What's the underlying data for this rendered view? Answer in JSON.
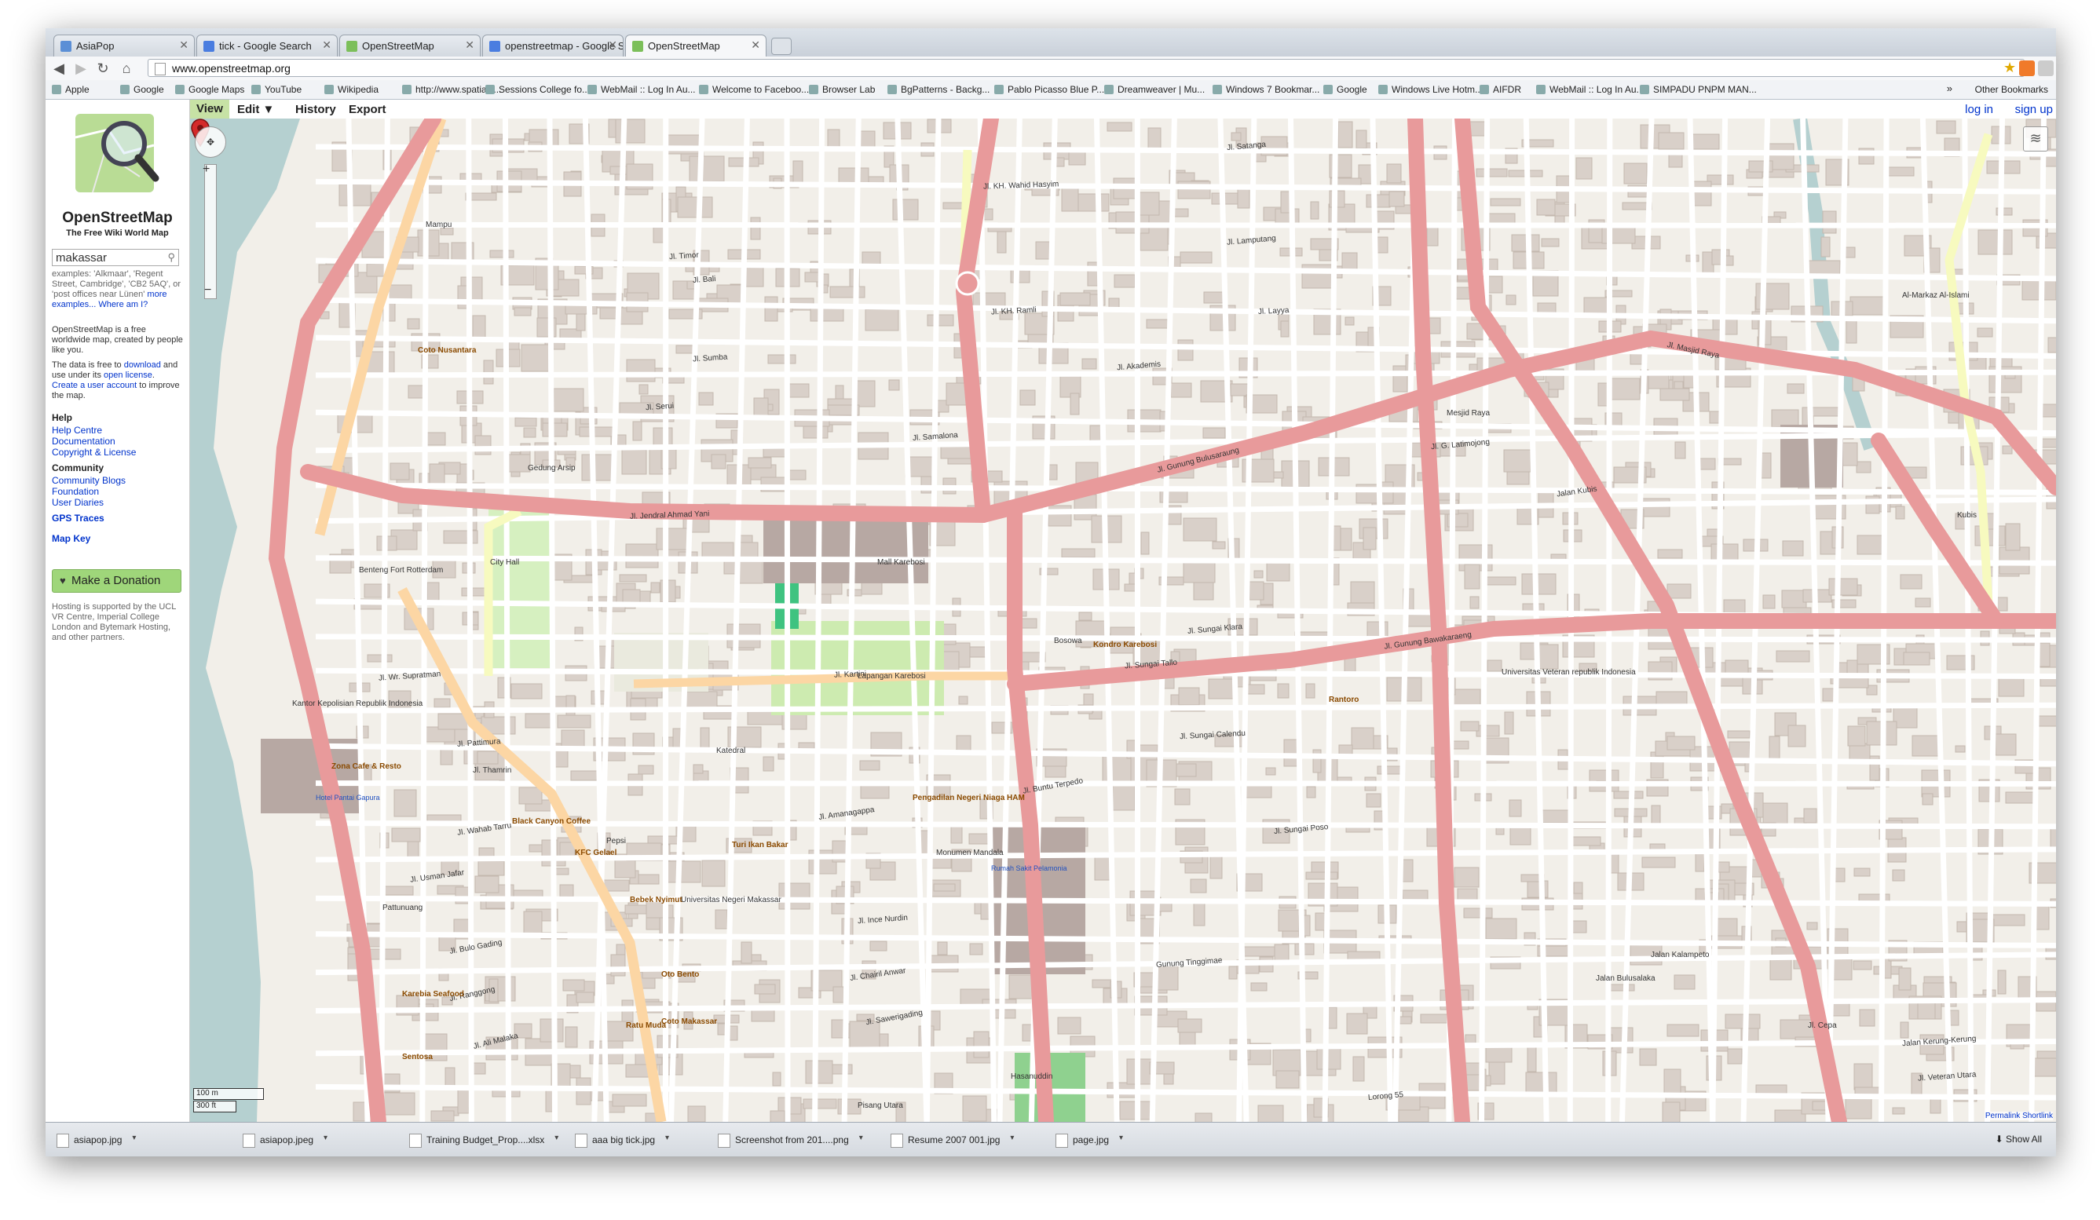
{
  "tabs": [
    {
      "title": "AsiaPop",
      "active": false
    },
    {
      "title": "tick - Google Search",
      "active": false
    },
    {
      "title": "OpenStreetMap",
      "active": false
    },
    {
      "title": "openstreetmap - Google S...",
      "active": false
    },
    {
      "title": "OpenStreetMap",
      "active": true
    }
  ],
  "toolbar": {
    "url": "www.openstreetmap.org"
  },
  "bookmarks": [
    "Apple",
    "Google",
    "Google Maps",
    "YouTube",
    "Wikipedia",
    "http://www.spatialc...",
    "Sessions College fo...",
    "WebMail :: Log In Au...",
    "Welcome to Faceboo...",
    "Browser Lab",
    "BgPatterns - Backg...",
    "Pablo Picasso Blue P...",
    "Dreamweaver | Mu...",
    "Windows 7 Bookmar...",
    "Google",
    "Windows Live Hotm...",
    "AIFDR",
    "WebMail :: Log In Au...",
    "SIMPADU PNPM MAN..."
  ],
  "other_bookmarks": "Other Bookmarks",
  "sidebar": {
    "site_name": "OpenStreetMap",
    "tagline": "The Free Wiki World Map",
    "search_value": "makassar",
    "search_examples": "examples: 'Alkmaar', 'Regent Street, Cambridge', 'CB2 5AQ', or 'post offices near Lünen'",
    "more_examples": "more examples...",
    "where_am_i": "Where am I?",
    "about_1": "OpenStreetMap is a free worldwide map, created by people like you.",
    "about_2a": "The data is free to",
    "download_link": "download",
    "about_2b": "and use under its",
    "license_link": "open license",
    "create_user_link": "Create a user account",
    "about_3": "to improve the map.",
    "help_heading": "Help",
    "help_links": [
      "Help Centre",
      "Documentation",
      "Copyright & License"
    ],
    "community_heading": "Community",
    "community_links": [
      "Community Blogs",
      "Foundation",
      "User Diaries"
    ],
    "gps_traces": "GPS Traces",
    "map_key": "Map Key",
    "donate": "Make a Donation",
    "hosting": "Hosting is supported by the UCL VR Centre, Imperial College London and Bytemark Hosting, and other partners."
  },
  "map_tabs": {
    "view": "View",
    "edit": "Edit ▼",
    "history": "History",
    "export": "Export",
    "login": "log in",
    "signup": "sign up"
  },
  "map": {
    "scale_m": "100 m",
    "scale_ft": "300 ft",
    "permalink": "Permalink Shortlink",
    "streets": [
      "Jl. Jendral Ahmad Yani",
      "Jl. Gunung Bulusaraung",
      "Jl. Masjid Raya",
      "Jl. Gunung Bawakaraeng",
      "Jl. Kartini",
      "Jl. Buntu Terpedo",
      "Jl. Sungai Klara",
      "Jl. Sungai Tallo",
      "Jl. Sungai Calendu",
      "Jl. Sungai Poso",
      "Jl. Amanagappa",
      "Jl. Thamrin",
      "Jl. Pattimura",
      "Jl. Wahab Tarru",
      "Jl. Ince Nurdin",
      "Jl. Chairil Anwar",
      "Jl. Sawerigading",
      "Jalan Bulusalaka",
      "Jalan Kerung-Kerung",
      "Jl. Veteran Utara",
      "Jl. Samalona",
      "Jl. Serui",
      "Jl. Sumba",
      "Jl. Timor",
      "Jl. Bali",
      "Jl. KH. Ramli",
      "Jl. Lamputang",
      "Jl. Layya",
      "Jl. Akademis",
      "Jl. Satanga",
      "Jl. KH. Wahid Hasyim",
      "Jl. Wr. Supratman",
      "Jl. Usman Jafar",
      "Jl. Bulo Gading",
      "Jl. Ranggong",
      "Jl. Ali Malaka",
      "Jl. G. Latimojong",
      "Jalan Kubis",
      "Jalan Kalampeto",
      "Jl. Cepa",
      "Gunung Tinggimae",
      "Lorong 55"
    ],
    "places": [
      "Mampu",
      "Lapangan Karebosi",
      "Mall Karebosi",
      "Hasanuddin",
      "Pisang Utara",
      "Pattunuang",
      "Mesjid Raya",
      "Al-Markaz Al-Islami",
      "Universitas Veteran republik Indonesia",
      "Universitas Negeri Makassar",
      "Benteng Fort Rotterdam",
      "City Hall",
      "Kubis",
      "Sentosa",
      "Karebia Seafood",
      "Oto Bento",
      "Coto Makassar",
      "Zona Cafe & Resto",
      "Kondro Karebosi",
      "Rantoro",
      "Pengadilan Negeri Niaga HAM",
      "Rumah Sakit Pelamonia",
      "Kantor Kepolisian Republik Indonesia",
      "Hotel Pantai Gapura",
      "Gedung Arsip",
      "Coto Nusantara",
      "Ratu Muda",
      "Bebek Nyimut",
      "Black Canyon Coffee",
      "Turi Ikan Bakar",
      "KFC Gelael",
      "Monumen Mandala",
      "Katedral",
      "Bosowa",
      "Pepsi"
    ]
  },
  "downloads": [
    "asiapop.jpg",
    "asiapop.jpeg",
    "Training Budget_Prop....xlsx",
    "aaa big tick.jpg",
    "Screenshot from 201....png",
    "Resume 2007 001.jpg",
    "page.jpg"
  ],
  "show_all": "Show All"
}
